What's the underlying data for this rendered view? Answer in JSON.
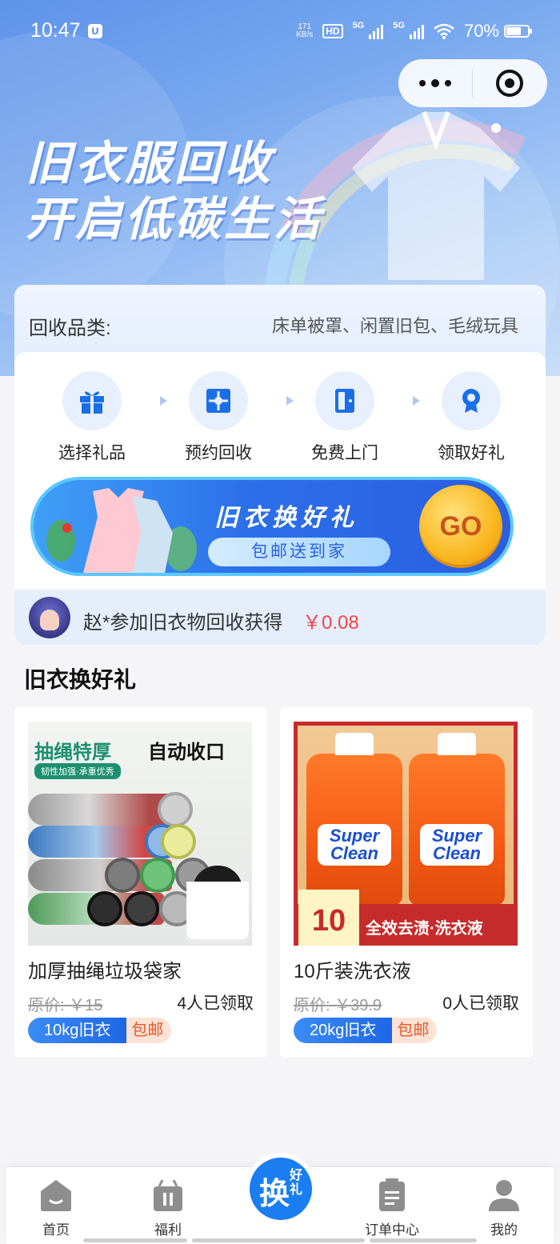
{
  "status_bar": {
    "time": "10:47",
    "speed_value": "171",
    "speed_unit": "KB/s",
    "hd_label": "HD",
    "network_1": "5G",
    "network_2": "5G",
    "battery_percent": "70%"
  },
  "hero": {
    "headline_line1": "旧衣服回收",
    "headline_line2": "开启低碳生活"
  },
  "categories": {
    "label": "回收品类:",
    "items_text": "床单被罩、闲置旧包、毛绒玩具"
  },
  "steps": [
    {
      "label": "选择礼品",
      "icon": "gift-icon"
    },
    {
      "label": "预约回收",
      "icon": "calendar-icon"
    },
    {
      "label": "免费上门",
      "icon": "door-icon"
    },
    {
      "label": "领取好礼",
      "icon": "medal-icon"
    }
  ],
  "banner": {
    "title": "旧衣换好礼",
    "pill": "包邮送到家",
    "go_label": "GO"
  },
  "ticker": {
    "text": "赵*参加旧衣物回收获得",
    "amount": "￥0.08"
  },
  "section": {
    "title": "旧衣换好礼"
  },
  "products": [
    {
      "name": "加厚抽绳垃圾袋家",
      "original_price": "原价: ￥15",
      "claimed": "4人已领取",
      "requirement": "10kg旧衣",
      "shipping": "包邮",
      "image_text": {
        "headline_a": "抽绳特厚",
        "headline_b": "自动收口",
        "sub": "韧性加强·承重优秀"
      }
    },
    {
      "name": "10斤装洗衣液",
      "original_price": "原价: ￥39.9",
      "claimed": "0人已领取",
      "requirement": "20kg旧衣",
      "shipping": "包邮",
      "image_text": {
        "brand": "Super Clean",
        "weight": "10斤",
        "band": "全效去渍·洗衣液"
      }
    }
  ],
  "tabbar": {
    "tabs": [
      {
        "label": "首页",
        "icon": "home-icon"
      },
      {
        "label": "福利",
        "icon": "welfare-icon"
      },
      {
        "label": "订单中心",
        "icon": "clipboard-icon"
      },
      {
        "label": "我的",
        "icon": "user-icon"
      }
    ],
    "center_main": "换",
    "center_sub": "好礼"
  },
  "colors": {
    "primary": "#1b7ef0",
    "accent_red": "#f04747",
    "hero_blue": "#5f93e9"
  }
}
